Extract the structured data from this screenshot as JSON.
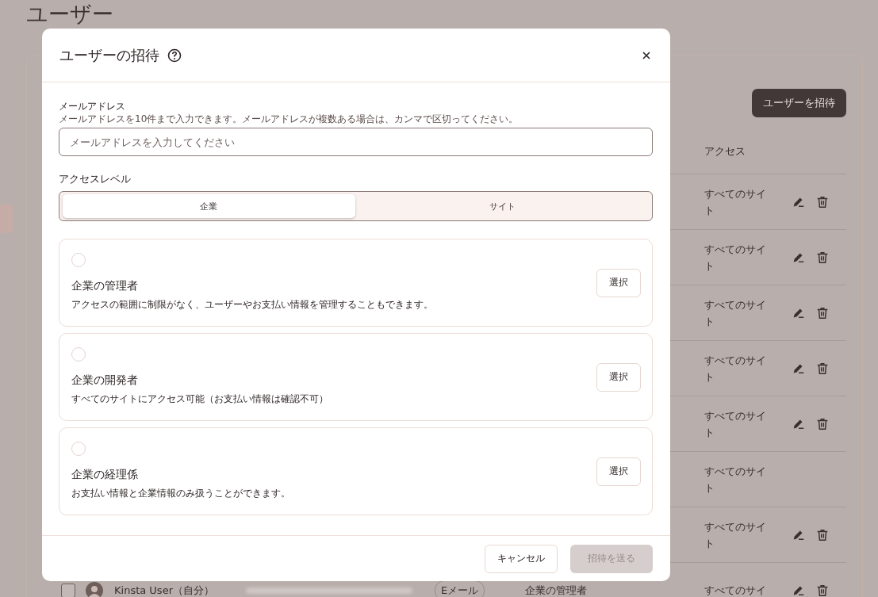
{
  "page": {
    "title": "ユーザー",
    "invite_button": "ユーザーを招待",
    "table": {
      "access_header": "アクセス",
      "rows": [
        {
          "access": "すべてのサイト",
          "actions": true
        },
        {
          "access": "すべてのサイト",
          "actions": true
        },
        {
          "access": "すべてのサイト",
          "actions": true
        },
        {
          "access": "すべてのサイト",
          "actions": true
        },
        {
          "access": "すべてのサイト",
          "actions": true
        },
        {
          "access": "すべてのサイト",
          "actions": false
        },
        {
          "access": "すべてのサイト",
          "actions": true
        },
        {
          "access": "すべてのサイ",
          "actions": true,
          "checked": false,
          "user": {
            "name": "Kinsta User（自分）",
            "badge": "Eメール",
            "role": "企業の管理者"
          }
        }
      ]
    }
  },
  "dialog": {
    "title": "ユーザーの招待",
    "email": {
      "label": "メールアドレス",
      "hint": "メールアドレスを10件まで入力できます。メールアドレスが複数ある場合は、カンマで区切ってください。",
      "placeholder": "メールアドレスを入力してください"
    },
    "access_level": {
      "label": "アクセスレベル",
      "tabs": [
        {
          "label": "企業",
          "selected": true
        },
        {
          "label": "サイト",
          "selected": false
        }
      ]
    },
    "roles": [
      {
        "title": "企業の管理者",
        "description": "アクセスの範囲に制限がなく、ユーザーやお支払い情報を管理することもできます。",
        "selected": false,
        "button": "選択"
      },
      {
        "title": "企業の開発者",
        "description": "すべてのサイトにアクセス可能（お支払い情報は確認不可）",
        "selected": false,
        "button": "選択"
      },
      {
        "title": "企業の経理係",
        "description": "お支払い情報と企業情報のみ扱うことができます。",
        "selected": false,
        "button": "選択"
      }
    ],
    "cancel_button": "キャンセル",
    "send_button": {
      "label": "招待を送る",
      "disabled": true
    }
  }
}
